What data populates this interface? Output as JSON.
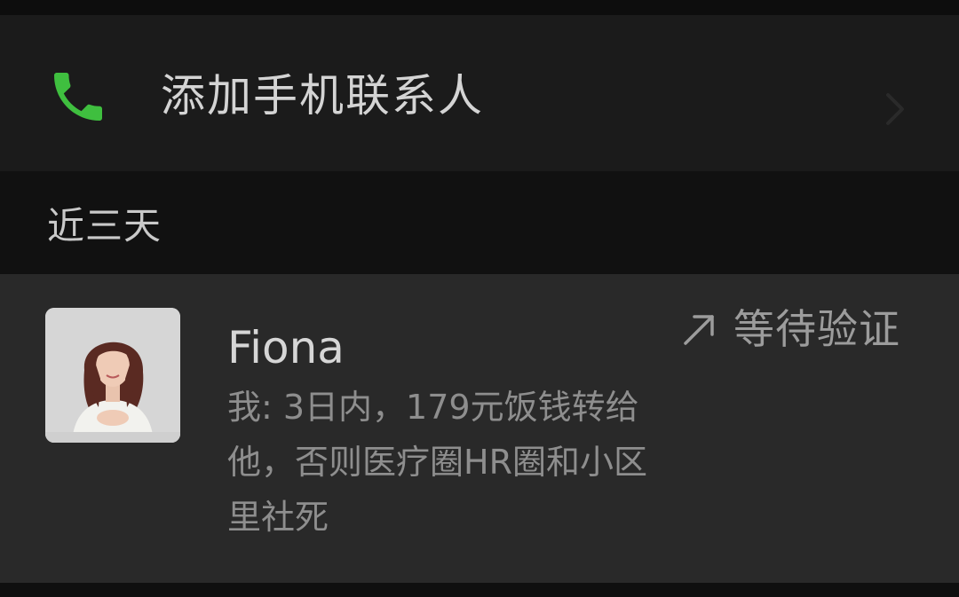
{
  "add_contacts": {
    "label": "添加手机联系人",
    "icon": "phone-icon",
    "icon_color": "#3fbf3f",
    "chevron": "chevron-right-icon"
  },
  "section": {
    "title": "近三天"
  },
  "requests": [
    {
      "name": "Fiona",
      "message": "我: 3日内，179元饭钱转给他，否则医疗圈HR圈和小区里社死",
      "status": "等待验证",
      "status_icon": "arrow-up-right-icon",
      "avatar": "profile-photo"
    }
  ]
}
